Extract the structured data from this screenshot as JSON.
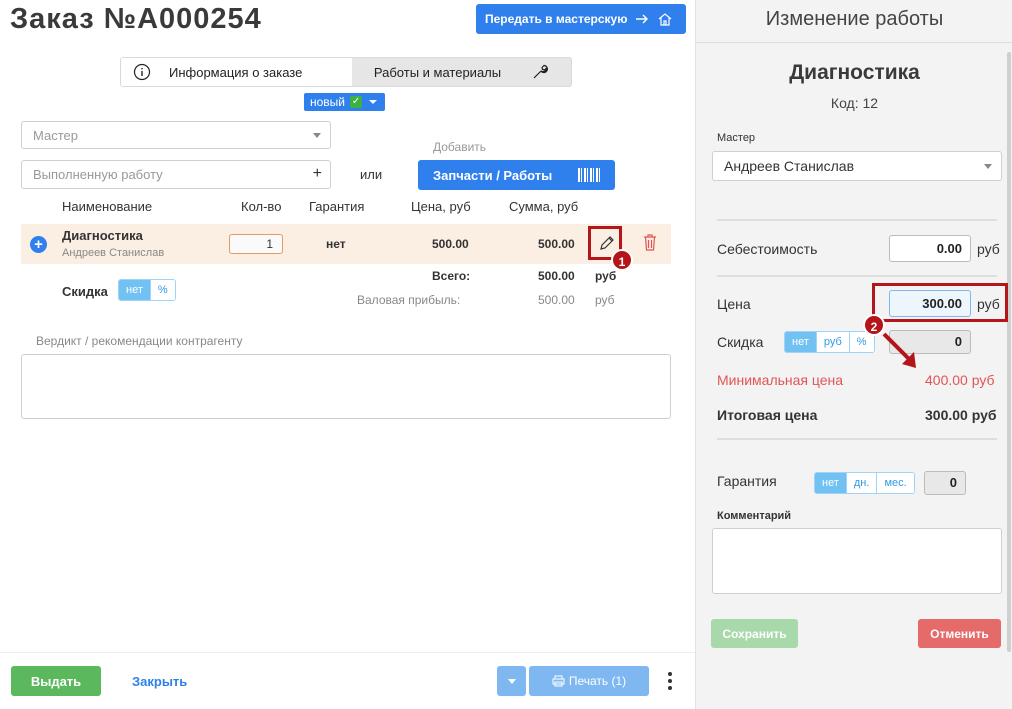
{
  "header": {
    "order_title": "Заказ №A000254",
    "transfer_button": "Передать в мастерскую"
  },
  "tabs": {
    "info": "Информация о заказе",
    "works": "Работы и материалы"
  },
  "status": {
    "label": "новый"
  },
  "form": {
    "master_placeholder": "Мастер",
    "work_placeholder": "Выполненную работу",
    "or_label": "или",
    "add_label": "Добавить",
    "parts_button": "Запчасти / Работы"
  },
  "table": {
    "headers": {
      "name": "Наименование",
      "qty": "Кол-во",
      "warranty": "Гарантия",
      "price": "Цена, руб",
      "sum": "Сумма, руб"
    },
    "row": {
      "name": "Диагностика",
      "master": "Андреев Станислав",
      "qty": "1",
      "warranty": "нет",
      "price": "500.00",
      "sum": "500.00"
    },
    "total_label": "Всего:",
    "total_value": "500.00",
    "total_unit": "руб",
    "profit_label": "Валовая прибыль:",
    "profit_value": "500.00",
    "profit_unit": "руб",
    "discount_label": "Скидка",
    "discount_options": [
      "нет",
      "%"
    ]
  },
  "verdict": {
    "label": "Вердикт / рекомендации контрагенту"
  },
  "footer": {
    "issue_button": "Выдать",
    "close_link": "Закрыть",
    "print_button": "Печать (1)"
  },
  "annotations": {
    "badge1": "1",
    "badge2": "2"
  },
  "panel": {
    "title": "Изменение работы",
    "work_name": "Диагностика",
    "work_code": "Код: 12",
    "master_label": "Мастер",
    "master_value": "Андреев Станислав",
    "cost_label": "Себестоимость",
    "cost_value": "0.00",
    "unit": "руб",
    "price_label": "Цена",
    "price_value": "300.00",
    "discount_label": "Скидка",
    "discount_options": [
      "нет",
      "руб",
      "%"
    ],
    "discount_value": "0",
    "min_price_label": "Минимальная цена",
    "min_price_value": "400.00 руб",
    "final_price_label": "Итоговая цена",
    "final_price_value": "300.00 руб",
    "warranty_label": "Гарантия",
    "warranty_options": [
      "нет",
      "дн.",
      "мес."
    ],
    "warranty_value": "0",
    "comment_label": "Комментарий",
    "save_button": "Сохранить",
    "cancel_button": "Отменить"
  },
  "colors": {
    "primary": "#2f80ed",
    "danger_outline": "#b3151a",
    "warning_text": "#e05555",
    "success": "#5cb85c"
  }
}
